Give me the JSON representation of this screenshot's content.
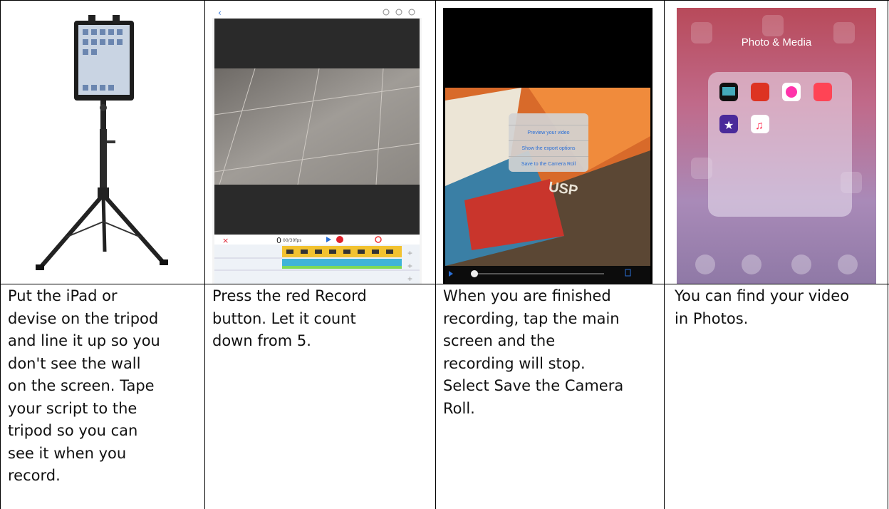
{
  "captions": {
    "step1": "Put the iPad or\ndevise on the tripod\nand line it up so you\ndon't see the wall\non the screen. Tape\nyour script to the\ntripod so you can\nsee it when you\nrecord.",
    "step2": "Press the red Record\nbutton.  Let it count\ndown from 5.",
    "step3": "When you are finished\nrecording, tap the main\nscreen and the\nrecording will stop.\nSelect Save the Camera\nRoll.",
    "step4": "You can find your video\nin Photos."
  },
  "screen2": {
    "timecode": "00/30fps",
    "record_color": "#e0202a",
    "clip_color": "#f2c230"
  },
  "screen3": {
    "menu": [
      "Preview your video",
      "Show the export options",
      "Save to the Camera Roll"
    ],
    "tag": "USP"
  },
  "screen4": {
    "folder_title": "Photo & Media",
    "apps": [
      "tv-icon",
      "photo-booth-icon",
      "photos-icon",
      "garageband-icon",
      "imovie-icon",
      "music-icon"
    ]
  }
}
